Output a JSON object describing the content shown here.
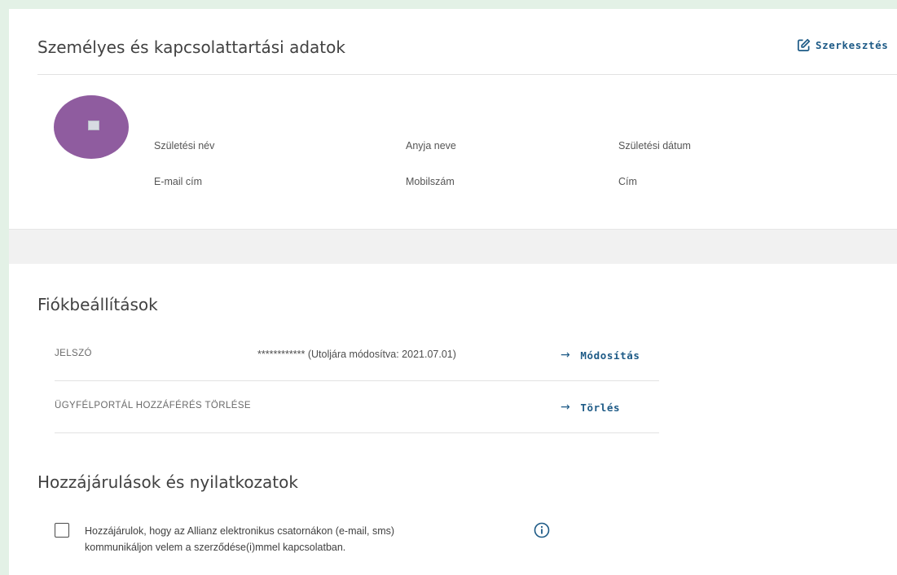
{
  "personal": {
    "title": "Személyes és kapcsolattartási adatok",
    "edit_label": "Szerkesztés",
    "fields": [
      {
        "label": "Születési név"
      },
      {
        "label": "Anyja neve"
      },
      {
        "label": "Születési dátum"
      },
      {
        "label": "E-mail cím"
      },
      {
        "label": "Mobilszám"
      },
      {
        "label": "Cím"
      }
    ]
  },
  "account": {
    "title": "Fiókbeállítások",
    "rows": [
      {
        "label": "JELSZÓ",
        "value": "************ (Utoljára módosítva: 2021.07.01)",
        "action": "Módosítás"
      },
      {
        "label": "ÜGYFÉLPORTÁL HOZZÁFÉRÉS TÖRLÉSE",
        "action": "Törlés"
      }
    ]
  },
  "consents": {
    "title": "Hozzájárulások és nyilatkozatok",
    "items": [
      {
        "text_line1": "Hozzájárulok, hogy az Allianz elektronikus csatornákon (e-mail, sms)",
        "text_line2": "kommunikáljon velem a szerződése(i)mmel kapcsolatban.",
        "checked": false
      }
    ]
  },
  "icons": {
    "edit": "edit-icon",
    "arrow": "arrow-right-icon",
    "info": "info-icon",
    "avatar_image": "broken-image-icon"
  },
  "colors": {
    "background": "#e3f1e6",
    "link": "#1d5a86",
    "avatar": "#8f5c9f"
  }
}
